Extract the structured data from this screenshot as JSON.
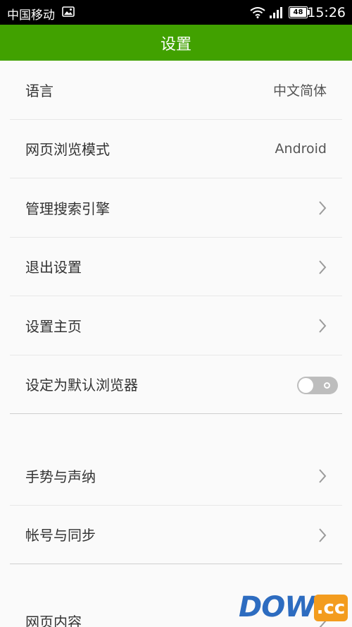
{
  "status_bar": {
    "carrier": "中国移动",
    "battery": "48",
    "time": "15:26"
  },
  "header": {
    "title": "设置"
  },
  "settings": {
    "group1": [
      {
        "label": "语言",
        "value": "中文简体"
      },
      {
        "label": "网页浏览模式",
        "value": "Android"
      },
      {
        "label": "管理搜索引擎"
      },
      {
        "label": "退出设置"
      },
      {
        "label": "设置主页"
      },
      {
        "label": "设定为默认浏览器",
        "toggle": false
      }
    ],
    "group2": [
      {
        "label": "手势与声纳"
      },
      {
        "label": "帐号与同步"
      }
    ],
    "group3": [
      {
        "label": "网页内容"
      }
    ]
  },
  "watermark": {
    "brand": "DOWN",
    "tld": ".cc"
  },
  "colors": {
    "accent": "#41a100",
    "status_bar": "#000000",
    "toggle_off": "#bdbdbd",
    "watermark_blue": "#2d6cc0",
    "watermark_orange": "#f39c1e"
  }
}
